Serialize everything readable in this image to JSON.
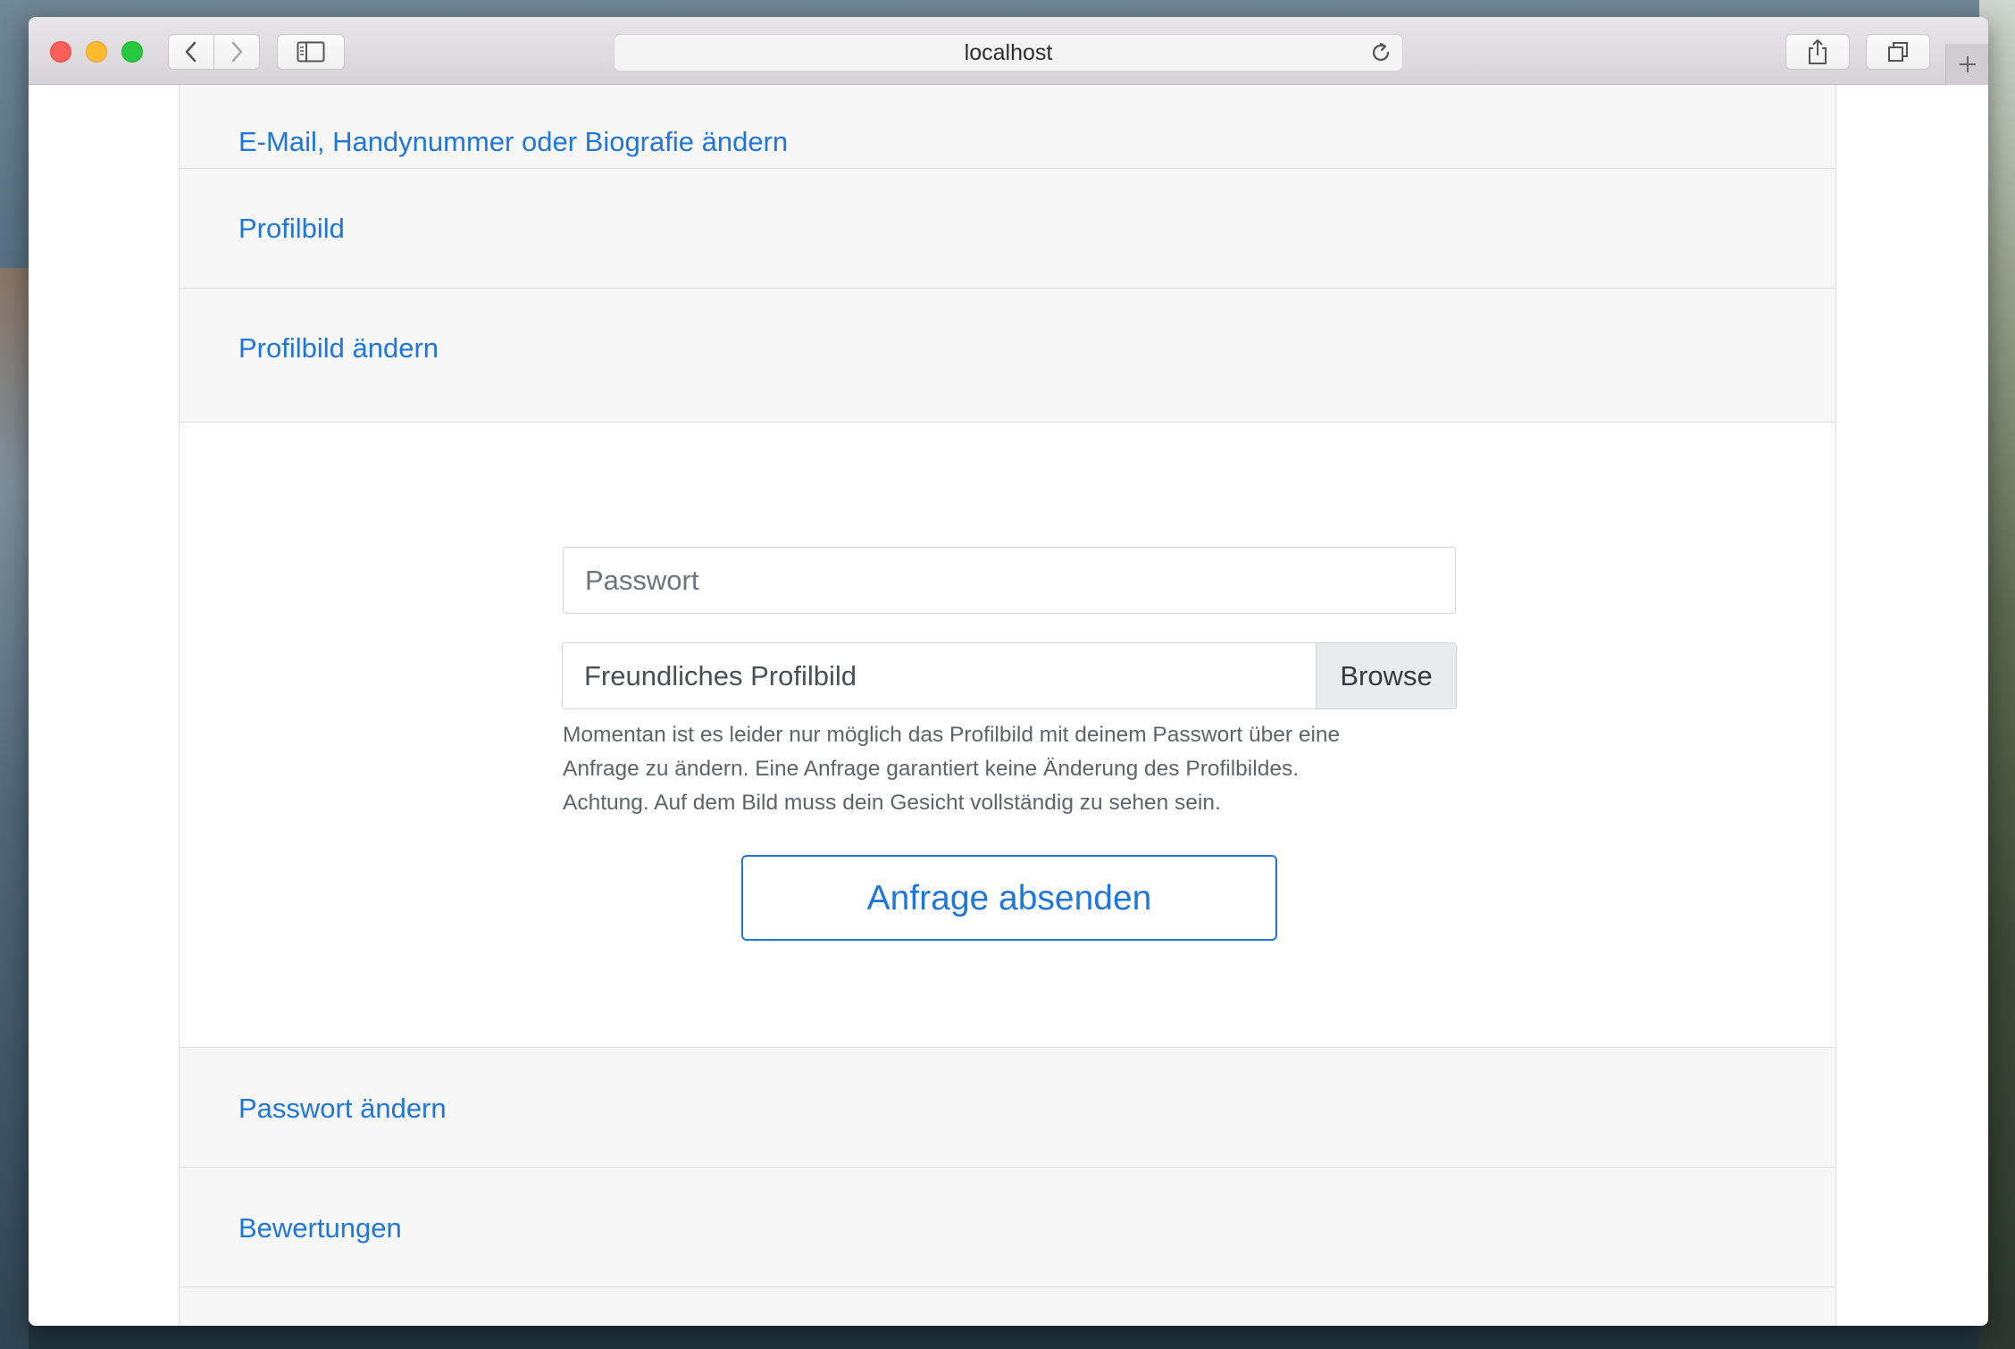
{
  "browser": {
    "address": "localhost",
    "icons": {
      "back": "chevron-left-icon",
      "forward": "chevron-right-icon",
      "sidebar": "sidebar-icon",
      "reload": "reload-icon",
      "share": "share-icon",
      "tabs": "tabs-overview-icon",
      "new_tab": "plus-icon"
    },
    "traffic_lights": {
      "close": "#fe5f57",
      "minimize": "#febc2e",
      "maximize": "#28c840"
    }
  },
  "accordion": {
    "sections": [
      {
        "label": "E-Mail, Handynummer oder Biografie ändern"
      },
      {
        "label": "Profilbild"
      },
      {
        "label": "Profilbild ändern"
      },
      {
        "label": "Passwort ändern"
      },
      {
        "label": "Bewertungen"
      }
    ]
  },
  "form": {
    "password_placeholder": "Passwort",
    "file_label": "Freundliches Profilbild",
    "browse_label": "Browse",
    "help_lines": [
      "Momentan ist es leider nur möglich das Profilbild mit deinem Passwort über eine",
      "Anfrage zu ändern. Eine Anfrage garantiert keine Änderung des Profilbildes.",
      "Achtung. Auf dem Bild muss dein Gesicht vollständig zu sehen sein."
    ],
    "submit_label": "Anfrage absenden"
  },
  "colors": {
    "link": "#1f76db",
    "header_bg": "#f7f7f7",
    "border": "#dfdfdf"
  }
}
